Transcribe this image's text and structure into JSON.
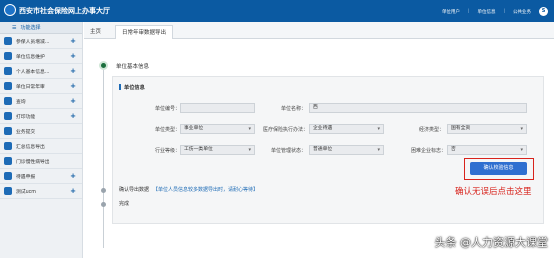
{
  "header": {
    "title": "西安市社会保险网上办事大厅",
    "user_label": "单位用户",
    "menu1": "单位信息",
    "menu2": "公共业务",
    "avatar_letter": "S"
  },
  "sidebar": {
    "head": "功能选择",
    "items": [
      {
        "label": "参保人员增减…",
        "has_plus": true
      },
      {
        "label": "单位信息维护",
        "has_plus": true
      },
      {
        "label": "个人基本信息…",
        "has_plus": true
      },
      {
        "label": "单位日常年审",
        "has_plus": true
      },
      {
        "label": "查询",
        "has_plus": true
      },
      {
        "label": "打印功能",
        "has_plus": true
      },
      {
        "label": "业务提交",
        "has_plus": false
      },
      {
        "label": "汇总信息导出",
        "has_plus": false
      },
      {
        "label": "门诊慢性病导出",
        "has_plus": false
      },
      {
        "label": "待遇申报",
        "has_plus": true
      },
      {
        "label": "测试ucm",
        "has_plus": true
      }
    ]
  },
  "tabs": [
    {
      "label": "主页"
    },
    {
      "label": "日常年审数据导出"
    }
  ],
  "steps": {
    "step1": "单位基本信息",
    "step2": "确认导出数据",
    "step2_hint": "【单位人员信息较多数据导出时，请耐心等待】",
    "step3": "完成"
  },
  "panel": {
    "title": "单位信息",
    "fields": {
      "unit_code_label": "单位编号：",
      "unit_code_value": "",
      "unit_name_label": "单位名称：",
      "unit_name_value": "西",
      "unit_type_label": "单位类型：",
      "unit_type_value": "事业单位",
      "med_label": "医疗保险执行办法：",
      "med_value": "企业待遇",
      "econ_label": "经济类型：",
      "econ_value": "国有全资",
      "industry_label": "行业等级：",
      "industry_value": "工伤一类单位",
      "mgmt_label": "单位管理状态：",
      "mgmt_value": "普通单位",
      "poor_label": "困难企业标志：",
      "poor_value": "否"
    },
    "confirm_button": "确认校验信息"
  },
  "annotation": "确认无误后点击这里",
  "watermark": "头条 @人力资源大课堂",
  "colors": {
    "topbar": "#0b5aa2",
    "accent": "#1d6bb6",
    "button": "#2f6fd0",
    "highlight_red": "#d8231c",
    "step_active": "#1a6f3d"
  }
}
